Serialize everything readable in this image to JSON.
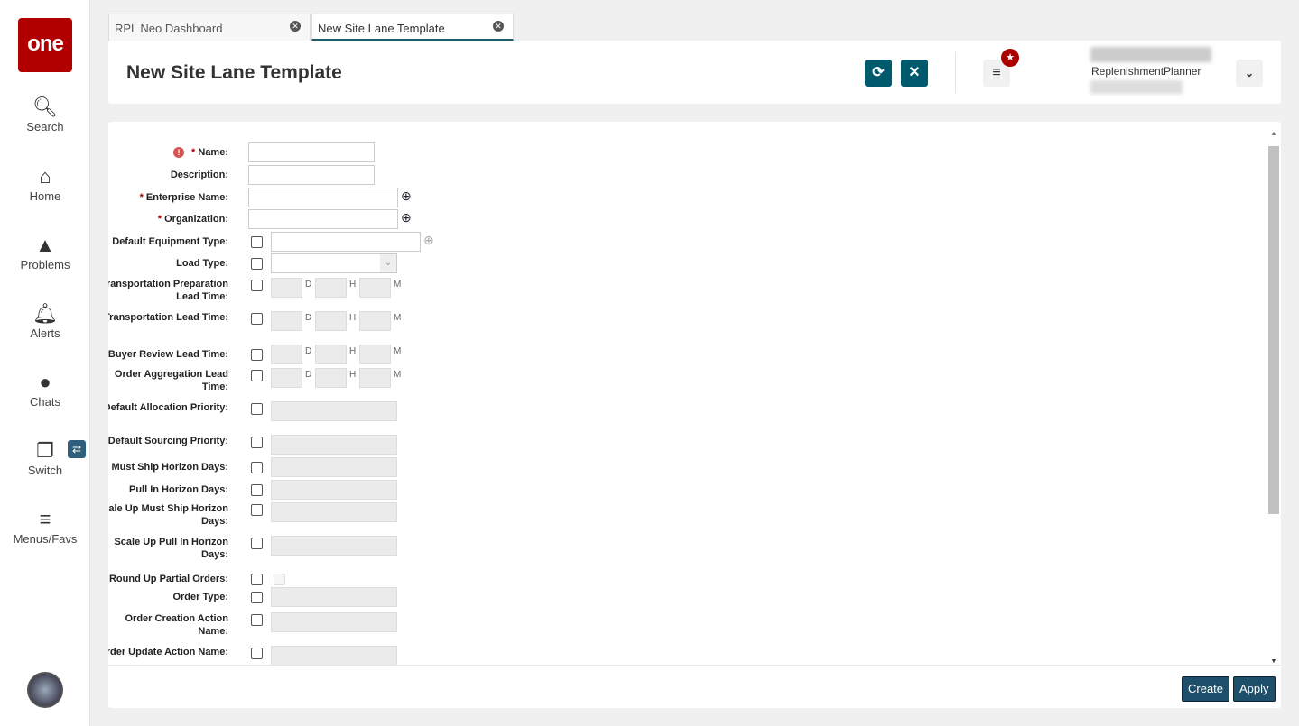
{
  "sidebar": {
    "logo": "one",
    "items": [
      {
        "label": "Search",
        "icon": "search-icon"
      },
      {
        "label": "Home",
        "icon": "home-icon"
      },
      {
        "label": "Problems",
        "icon": "warning-icon"
      },
      {
        "label": "Alerts",
        "icon": "bell-icon"
      },
      {
        "label": "Chats",
        "icon": "chat-icon"
      },
      {
        "label": "Switch",
        "icon": "switch-icon"
      },
      {
        "label": "Menus/Favs",
        "icon": "menu-icon"
      }
    ]
  },
  "tabs": [
    {
      "label": "RPL Neo Dashboard",
      "active": false
    },
    {
      "label": "New Site Lane Template",
      "active": true
    }
  ],
  "header": {
    "title": "New Site Lane Template",
    "user_role": "ReplenishmentPlanner"
  },
  "form": {
    "units": [
      "D",
      "H",
      "M"
    ],
    "rows": [
      {
        "label": "Name:",
        "required": true,
        "error": true,
        "type": "text"
      },
      {
        "label": "Description:",
        "type": "text"
      },
      {
        "label": "Enterprise Name:",
        "required": true,
        "type": "lookup"
      },
      {
        "label": "Organization:",
        "required": true,
        "type": "lookup"
      },
      {
        "label": "Default Equipment Type:",
        "type": "check-lookup"
      },
      {
        "label": "Load Type:",
        "type": "check-select"
      },
      {
        "label": "Transportation Preparation Lead Time:",
        "type": "check-dhm"
      },
      {
        "label": "Transportation Lead Time:",
        "type": "check-dhm"
      },
      {
        "label": "Buyer Review Lead Time:",
        "type": "check-dhm"
      },
      {
        "label": "Order Aggregation Lead Time:",
        "type": "check-dhm"
      },
      {
        "label": "Default Allocation Priority:",
        "type": "check-input"
      },
      {
        "label": "Default Sourcing Priority:",
        "type": "check-input"
      },
      {
        "label": "Must Ship Horizon Days:",
        "type": "check-input"
      },
      {
        "label": "Pull In Horizon Days:",
        "type": "check-input"
      },
      {
        "label": "Scale Up Must Ship Horizon Days:",
        "type": "check-input"
      },
      {
        "label": "Scale Up Pull In Horizon Days:",
        "type": "check-input"
      },
      {
        "label": "Round Up Partial Orders:",
        "type": "check-checkbox"
      },
      {
        "label": "Order Type:",
        "type": "check-input"
      },
      {
        "label": "Order Creation Action Name:",
        "type": "check-input"
      },
      {
        "label": "Order Update Action Name:",
        "type": "check-input"
      }
    ]
  },
  "footer": {
    "create": "Create",
    "apply": "Apply"
  }
}
